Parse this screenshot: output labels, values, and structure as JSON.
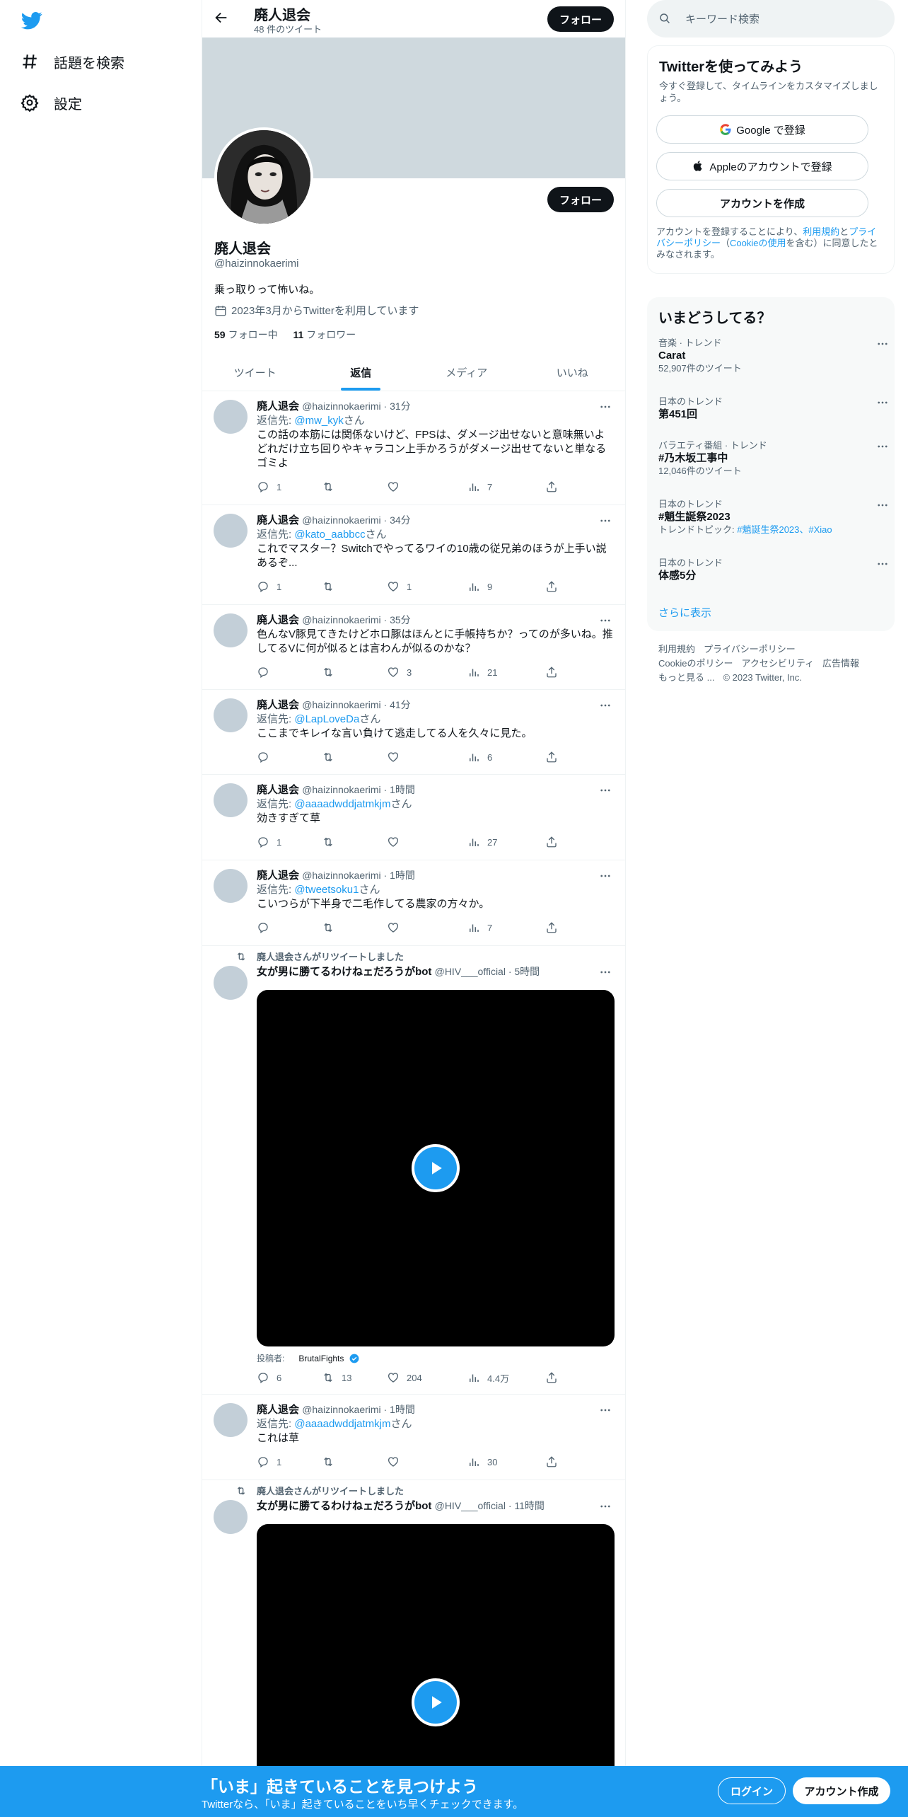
{
  "nav": {
    "items": [
      {
        "label": "話題を検索",
        "icon": "hashtag-icon"
      },
      {
        "label": "設定",
        "icon": "gear-icon"
      }
    ]
  },
  "header": {
    "title": "廃人退会",
    "tweet_count": "48 件のツイート",
    "follow_label": "フォロー"
  },
  "profile": {
    "name": "廃人退会",
    "handle": "@haizinnokaerimi",
    "bio": "乗っ取りって怖いね。",
    "joined": "2023年3月からTwitterを利用しています",
    "following_count": "59",
    "following_label": "フォロー中",
    "followers_count": "11",
    "followers_label": "フォロワー",
    "follow_label": "フォロー"
  },
  "tabs": [
    {
      "label": "ツイート",
      "active": false
    },
    {
      "label": "返信",
      "active": true
    },
    {
      "label": "メディア",
      "active": false
    },
    {
      "label": "いいね",
      "active": false
    }
  ],
  "tweets": [
    {
      "name": "廃人退会",
      "meta": "@haizinnokaerimi · 31分",
      "reply_prefix": "返信先: ",
      "reply_to": "@mw_kyk",
      "reply_suffix": "さん",
      "text": "この話の本筋には関係ないけど、FPSは、ダメージ出せないと意味無いよどれだけ立ち回りやキャラコン上手かろうがダメージ出せてないと単なるゴミよ",
      "replies": "1",
      "retweets": "",
      "likes": "",
      "views": "7"
    },
    {
      "name": "廃人退会",
      "meta": "@haizinnokaerimi · 34分",
      "reply_prefix": "返信先: ",
      "reply_to": "@kato_aabbcc",
      "reply_suffix": "さん",
      "text": "これでマスター？Switchでやってるワイの10歳の従兄弟のほうが上手い説あるぞ...",
      "replies": "1",
      "retweets": "",
      "likes": "1",
      "views": "9"
    },
    {
      "name": "廃人退会",
      "meta": "@haizinnokaerimi · 35分",
      "text": "色んなV豚見てきたけどホロ豚はほんとに手帳持ちか？ってのが多いね。推してるVに何が似るとは言わんが似るのかな？",
      "replies": "",
      "retweets": "",
      "likes": "3",
      "views": "21"
    },
    {
      "name": "廃人退会",
      "meta": "@haizinnokaerimi · 41分",
      "reply_prefix": "返信先: ",
      "reply_to": "@LapLoveDa",
      "reply_suffix": "さん",
      "text": "ここまでキレイな言い負けて逃走してる人を久々に見た。",
      "replies": "",
      "retweets": "",
      "likes": "",
      "views": "6"
    },
    {
      "name": "廃人退会",
      "meta": "@haizinnokaerimi · 1時間",
      "reply_prefix": "返信先: ",
      "reply_to": "@aaaadwddjatmkjm",
      "reply_suffix": "さん",
      "text": "効きすぎて草",
      "replies": "1",
      "retweets": "",
      "likes": "",
      "views": "27"
    },
    {
      "name": "廃人退会",
      "meta": "@haizinnokaerimi · 1時間",
      "reply_prefix": "返信先: ",
      "reply_to": "@tweetsoku1",
      "reply_suffix": "さん",
      "text": "こいつらが下半身で二毛作してる農家の方々か。",
      "replies": "",
      "retweets": "",
      "likes": "",
      "views": "7"
    }
  ],
  "retweet1": {
    "note": "廃人退会さんがリツイートしました",
    "name": "女が男に勝てるわけねェだろうがbot",
    "meta": "@HIV___official · 5時間",
    "poster_label": "投稿者:",
    "poster_name": "BrutalFights",
    "replies": "6",
    "retweets": "13",
    "likes": "204",
    "views": "4.4万"
  },
  "tweet7": {
    "name": "廃人退会",
    "meta": "@haizinnokaerimi · 1時間",
    "reply_prefix": "返信先: ",
    "reply_to": "@aaaadwddjatmkjm",
    "reply_suffix": "さん",
    "text": "これは草",
    "replies": "1",
    "retweets": "",
    "likes": "",
    "views": "30"
  },
  "retweet2": {
    "note": "廃人退会さんがリツイートしました",
    "name": "女が男に勝てるわけねェだろうがbot",
    "meta": "@HIV___official · 11時間"
  },
  "sidebar": {
    "search_placeholder": "キーワード検索",
    "signup": {
      "title": "Twitterを使ってみよう",
      "subtitle": "今すぐ登録して、タイムラインをカスタマイズしましょう。",
      "google": "Google で登録",
      "apple": "Appleのアカウントで登録",
      "create": "アカウントを作成",
      "note_a": "アカウントを登録することにより、",
      "note_terms": "利用規約",
      "note_b": "と",
      "note_privacy": "プライバシーポリシー",
      "note_c": "（",
      "note_cookie": "Cookieの使用",
      "note_d": "を含む）に同意したとみなされます。"
    },
    "trends_title": "いまどうしてる？",
    "trends": [
      {
        "meta": "音楽 · トレンド",
        "name": "Carat",
        "sub": "52,907件のツイート"
      },
      {
        "meta": "日本のトレンド",
        "name": "第451回",
        "sub": ""
      },
      {
        "meta": "バラエティ番組 · トレンド",
        "name": "#乃木坂工事中",
        "sub": "12,046件のツイート"
      },
      {
        "meta": "日本のトレンド",
        "name": "#魈生誕祭2023",
        "sub_prefix": "トレンドトピック: ",
        "sub_links": "#魈誕生祭2023、#Xiao"
      },
      {
        "meta": "日本のトレンド",
        "name": "体感5分",
        "sub": ""
      }
    ],
    "show_more": "さらに表示",
    "footer": [
      "利用規約",
      "プライバシーポリシー",
      "Cookieのポリシー",
      "アクセシビリティ",
      "広告情報",
      "もっと見る ...",
      "© 2023 Twitter, Inc."
    ]
  },
  "bottom": {
    "title": "「いま」起きていることを見つけよう",
    "subtitle": "Twitterなら、「いま」起きていることをいち早くチェックできます。",
    "login": "ログイン",
    "signup": "アカウント作成"
  },
  "colors": {
    "accent": "#1d9bf0",
    "text": "#0f1419",
    "muted": "#536471"
  }
}
